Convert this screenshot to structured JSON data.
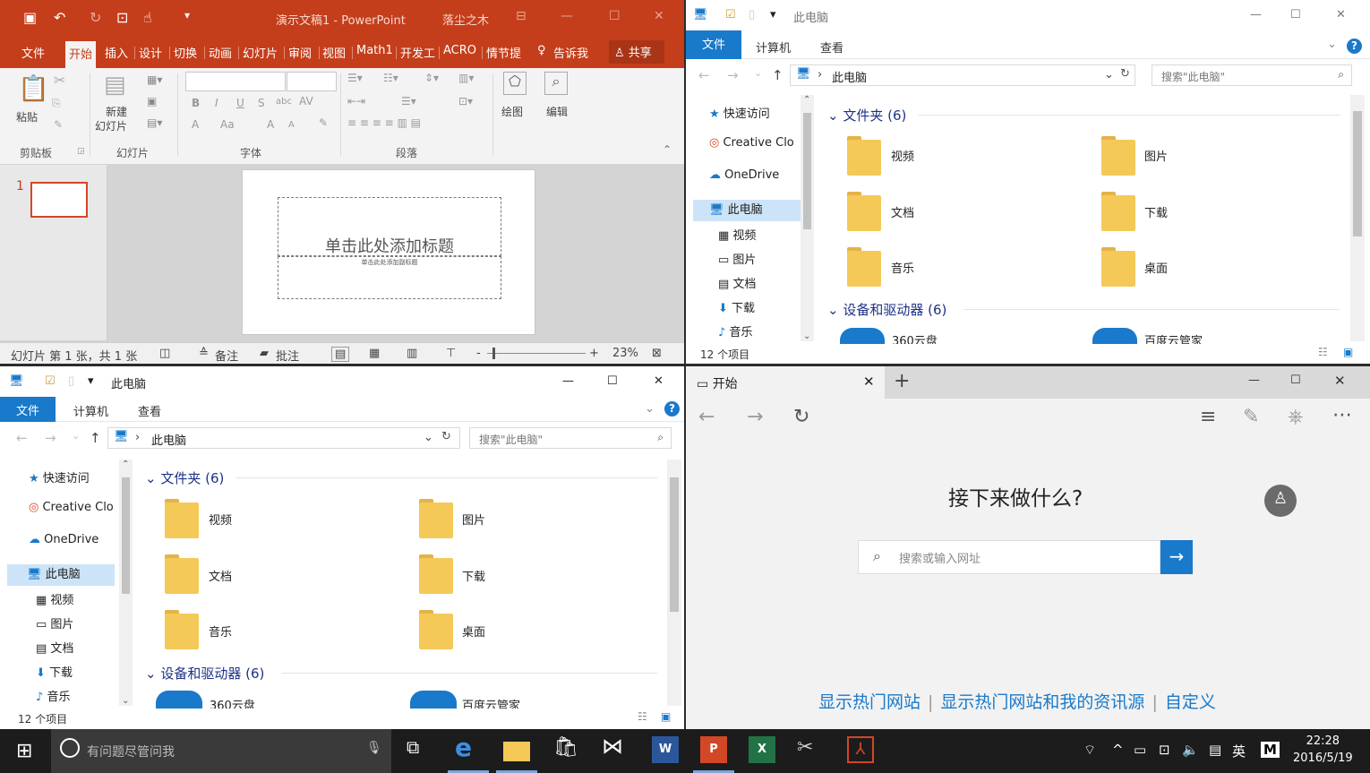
{
  "ppt": {
    "title": "演示文稿1 - PowerPoint",
    "user": "落尘之木",
    "tabs": [
      "文件",
      "开始",
      "插入",
      "设计",
      "切换",
      "动画",
      "幻灯片",
      "审阅",
      "视图",
      "Math1",
      "开发工",
      "ACRO",
      "情节提"
    ],
    "tell": "告诉我",
    "share": "共享",
    "ribbon": {
      "paste": "粘贴",
      "new_slide_1": "新建",
      "new_slide_2": "幻灯片",
      "draw": "绘图",
      "edit": "编辑",
      "groups": [
        "剪贴板",
        "幻灯片",
        "字体",
        "段落"
      ]
    },
    "slide_num": "1",
    "slide_title": "单击此处添加标题",
    "slide_sub": "单击此处添加副标题",
    "status": {
      "slide": "幻灯片 第 1 张，共 1 张",
      "notes": "备注",
      "comments": "批注",
      "zoom": "23%"
    }
  },
  "explorer": {
    "title": "此电脑",
    "file": "文件",
    "computer": "计算机",
    "view": "查看",
    "addr": "此电脑",
    "search": "搜索\"此电脑\"",
    "nav": [
      {
        "label": "快速访问"
      },
      {
        "label": "Creative Clo"
      },
      {
        "label": "OneDrive"
      },
      {
        "label": "此电脑"
      },
      {
        "label": "视频"
      },
      {
        "label": "图片"
      },
      {
        "label": "文档"
      },
      {
        "label": "下载"
      },
      {
        "label": "音乐"
      }
    ],
    "folders_header": "文件夹 (6)",
    "folders": [
      "视频",
      "图片",
      "文档",
      "下载",
      "音乐",
      "桌面"
    ],
    "devices_header": "设备和驱动器 (6)",
    "devices": [
      "360云盘",
      "百度云管家"
    ],
    "count": "12 个项目"
  },
  "edge": {
    "tab": "开始",
    "heading": "接下来做什么?",
    "search_placeholder": "搜索或输入网址",
    "links": [
      "显示热门网站",
      "显示热门网站和我的资讯源",
      "自定义"
    ]
  },
  "taskbar": {
    "search": "有问题尽管问我",
    "ime": "英",
    "time": "22:28",
    "date": "2016/5/19"
  }
}
